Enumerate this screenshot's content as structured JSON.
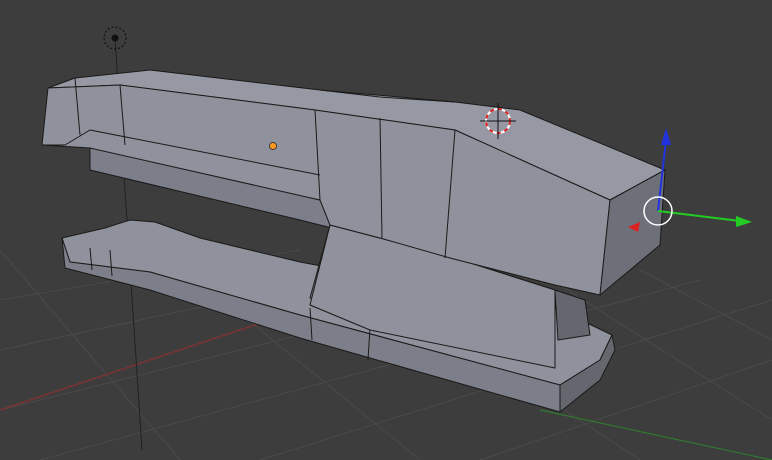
{
  "viewport": {
    "background": "#3d3d3d",
    "grid_color": "#4a4a4a",
    "axis_x_color": "#8a2f2f",
    "axis_y_color": "#2f7a2f",
    "mesh_face_light": "#8f929c",
    "mesh_face_mid": "#7c7f8a",
    "mesh_face_dark": "#65676f",
    "mesh_edge_color": "#1a1a1a"
  },
  "gizmo": {
    "x_axis_color": "#dd2222",
    "y_axis_color": "#22cc22",
    "z_axis_color": "#2233dd",
    "center_ring_color": "#ffffff"
  },
  "origin_dot_color": "#ff9922",
  "icons": [
    "lamp-icon",
    "3d-cursor-icon",
    "object-origin-icon"
  ]
}
